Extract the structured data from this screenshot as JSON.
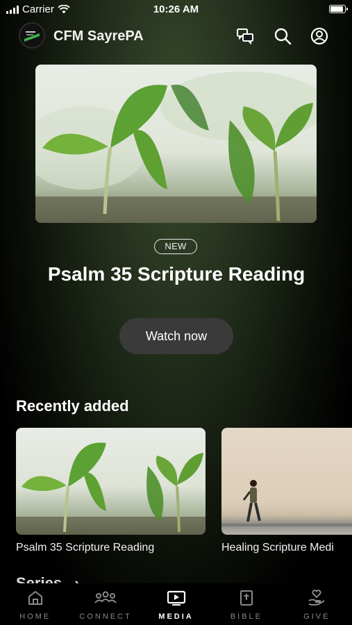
{
  "status_bar": {
    "carrier": "Carrier",
    "time": "10:26 AM"
  },
  "header": {
    "app_title": "CFM SayrePA",
    "icons": [
      "chat-icon",
      "search-icon",
      "profile-icon"
    ]
  },
  "hero": {
    "badge": "NEW",
    "title": "Psalm 35 Scripture Reading",
    "button_label": "Watch now"
  },
  "recently_added": {
    "title": "Recently added",
    "items": [
      {
        "label": "Psalm 35 Scripture Reading"
      },
      {
        "label": "Healing Scripture Medi"
      }
    ]
  },
  "series": {
    "title": "Series",
    "arrow": "›"
  },
  "tabbar": {
    "items": [
      {
        "label": "HOME",
        "icon": "home-icon"
      },
      {
        "label": "CONNECT",
        "icon": "people-icon"
      },
      {
        "label": "MEDIA",
        "icon": "media-icon",
        "active": true
      },
      {
        "label": "BIBLE",
        "icon": "bible-icon"
      },
      {
        "label": "GIVE",
        "icon": "give-icon"
      }
    ]
  },
  "colors": {
    "accent_active": "#ffffff",
    "tab_inactive": "#8a8a8a",
    "button_bg": "#3a3a3a"
  }
}
